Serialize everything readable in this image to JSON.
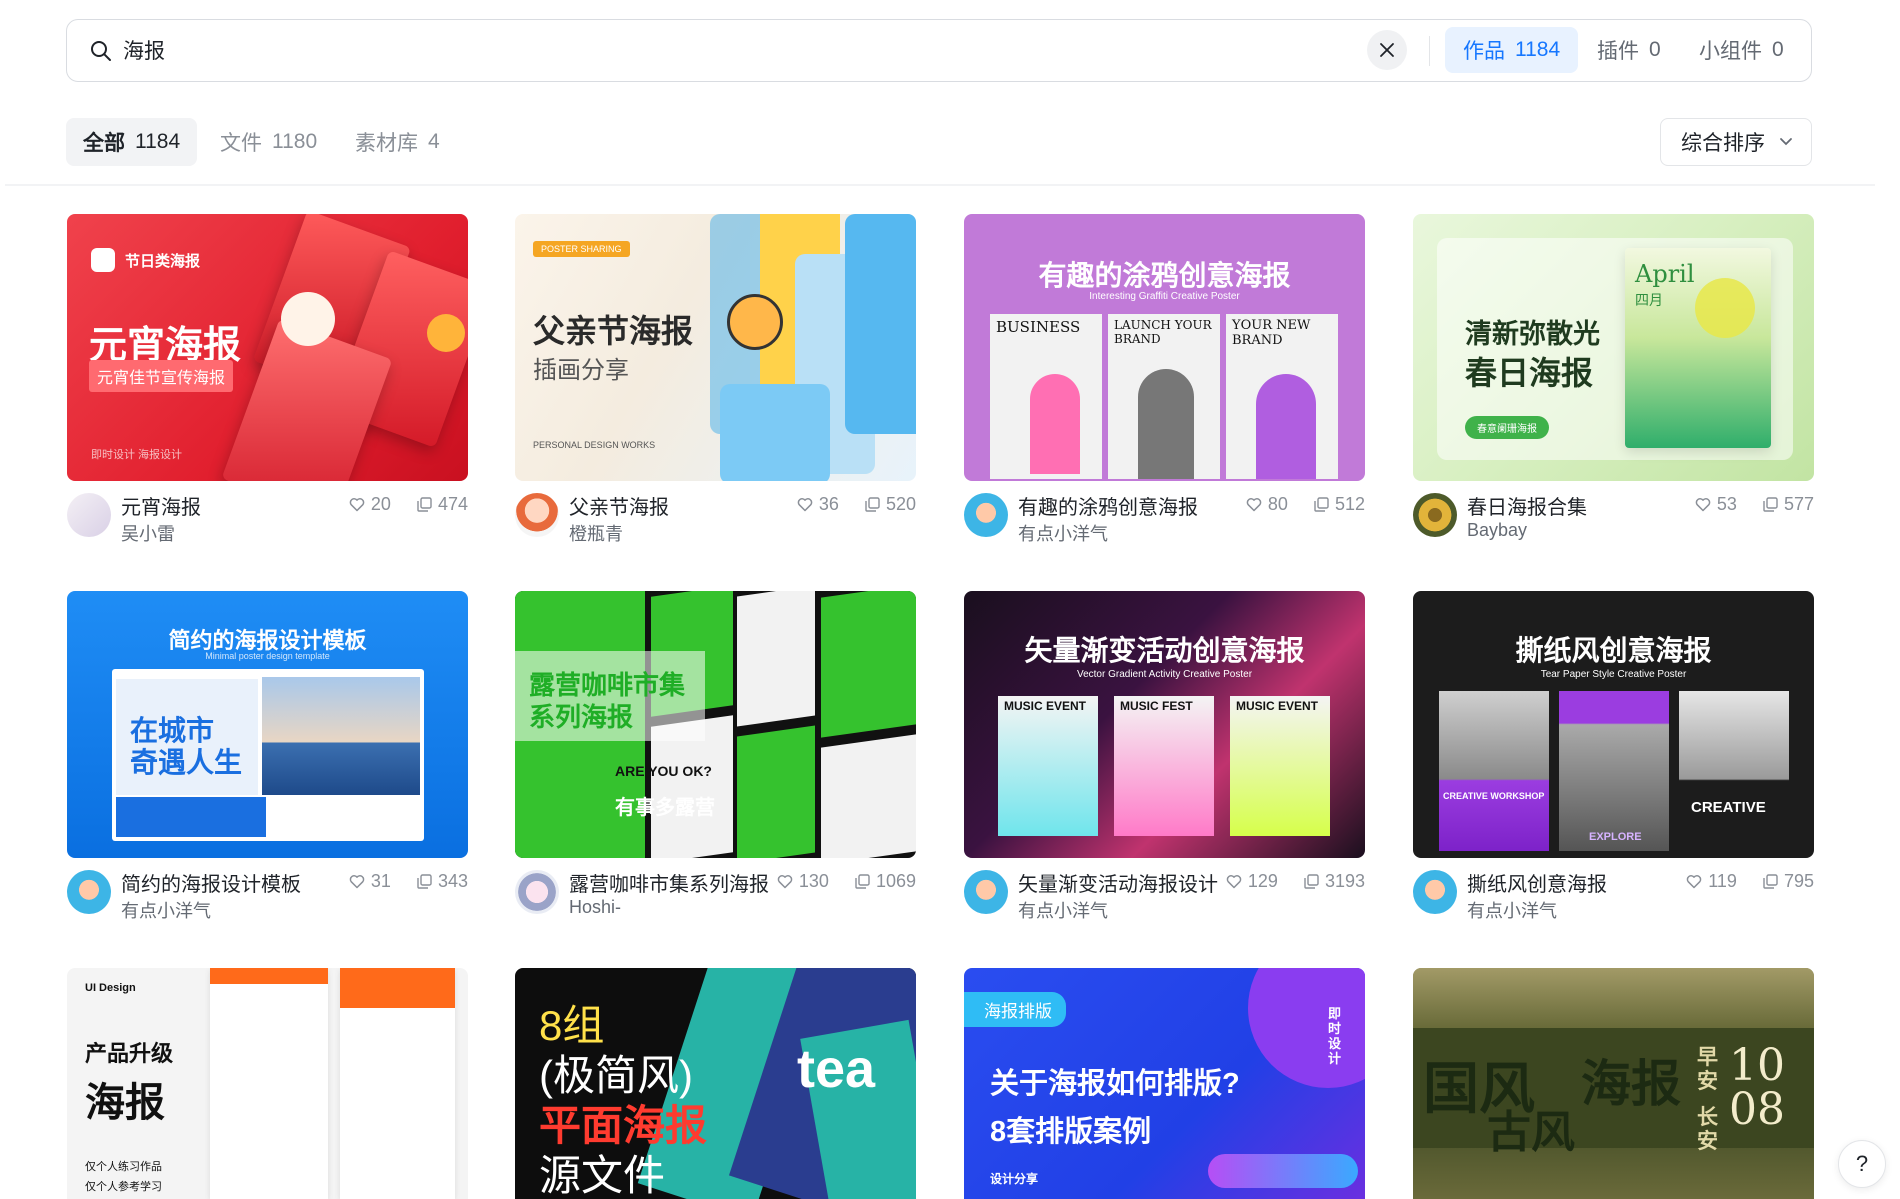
{
  "search": {
    "query": "海报",
    "tabs": [
      {
        "label": "作品",
        "count": "1184"
      },
      {
        "label": "插件",
        "count": "0"
      },
      {
        "label": "小组件",
        "count": "0"
      }
    ]
  },
  "filters": {
    "tabs": [
      {
        "label": "全部",
        "count": "1184"
      },
      {
        "label": "文件",
        "count": "1180"
      },
      {
        "label": "素材库",
        "count": "4"
      }
    ],
    "sort_label": "综合排序"
  },
  "colors": {
    "accent": "#1677ff",
    "accent_bg": "#e8f2ff"
  },
  "cards": [
    {
      "title": "元宵海报",
      "author": "吴小雷",
      "likes": "20",
      "views": "474",
      "thumb": {
        "badge": "节日类海报",
        "headline": "元宵海报",
        "sub": "元宵佳节宣传海报",
        "foot": "即时设计 海报设计"
      }
    },
    {
      "title": "父亲节海报",
      "author": "橙瓶青",
      "likes": "36",
      "views": "520",
      "thumb": {
        "tag": "POSTER SHARING",
        "headline": "父亲节海报",
        "sub": "插画分享",
        "foot": "PERSONAL DESIGN WORKS"
      }
    },
    {
      "title": "有趣的涂鸦创意海报",
      "author": "有点小洋气",
      "likes": "80",
      "views": "512",
      "thumb": {
        "headline": "有趣的涂鸦创意海报",
        "sub": "Interesting Graffiti Creative Poster",
        "p1": "BUSINESS",
        "p2": "LAUNCH YOUR BRAND",
        "p3": "YOUR NEW BRAND"
      }
    },
    {
      "title": "春日海报合集",
      "author": "Baybay",
      "likes": "53",
      "views": "577",
      "thumb": {
        "headline": "清新弥散光",
        "headline2": "春日海报",
        "pill": "春意阑珊海报",
        "poster": "April",
        "poster_sub": "四月"
      }
    },
    {
      "title": "简约的海报设计模板",
      "author": "有点小洋气",
      "likes": "31",
      "views": "343",
      "thumb": {
        "headline": "简约的海报设计模板",
        "sub": "Minimal poster design template",
        "inner1": "在城市",
        "inner2": "奇遇人生"
      }
    },
    {
      "title": "露营咖啡市集系列海报",
      "author": "Hoshi-",
      "likes": "130",
      "views": "1069",
      "thumb": {
        "headline": "露营咖啡市集",
        "headline2": "系列海报",
        "p1": "ARE YOU OK?",
        "p2": "有事多露营"
      }
    },
    {
      "title": "矢量渐变活动海报设计",
      "author": "有点小洋气",
      "likes": "129",
      "views": "3193",
      "thumb": {
        "headline": "矢量渐变活动创意海报",
        "sub": "Vector Gradient Activity Creative Poster",
        "p1": "MUSIC EVENT",
        "p2": "MUSIC FEST",
        "p3": "MUSIC EVENT"
      }
    },
    {
      "title": "撕纸风创意海报",
      "author": "有点小洋气",
      "likes": "119",
      "views": "795",
      "thumb": {
        "headline": "撕纸风创意海报",
        "sub": "Tear Paper Style Creative Poster",
        "p1": "CREATIVE WORKSHOP",
        "p2": "EXPLORE",
        "p3": "CREATIVE"
      }
    },
    {
      "title": "",
      "author": "",
      "likes": "",
      "views": "",
      "thumb": {
        "tag": "UI Design",
        "headline": "产品升级",
        "headline2": "海报",
        "note1": "仅个人练习作品",
        "note2": "仅个人参考学习"
      }
    },
    {
      "title": "",
      "author": "",
      "likes": "",
      "views": "",
      "thumb": {
        "l1": "8组",
        "l2": "(极简风)",
        "l3": "平面海报",
        "l4": "源文件",
        "side": "tea"
      }
    },
    {
      "title": "",
      "author": "",
      "likes": "",
      "views": "",
      "thumb": {
        "tag": "海报排版",
        "headline": "关于海报如何排版?",
        "headline2": "8套排版案例",
        "foot": "设计分享",
        "side": "即时设计"
      }
    },
    {
      "title": "",
      "author": "",
      "likes": "",
      "views": "",
      "thumb": {
        "l1": "国风",
        "l2": "古风",
        "l3": "海报",
        "side1": "早安",
        "side2": "长安",
        "num1": "10",
        "num2": "08"
      }
    }
  ]
}
